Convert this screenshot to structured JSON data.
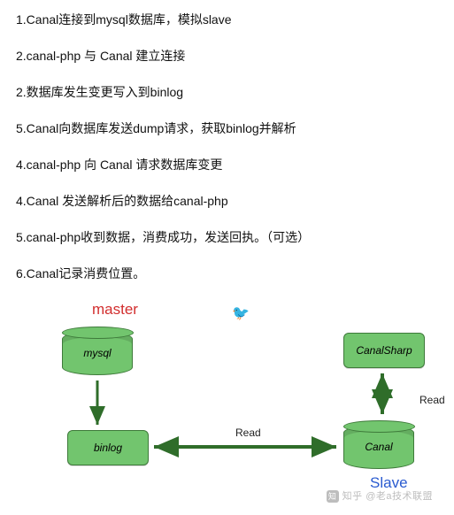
{
  "steps": {
    "s1": "1.Canal连接到mysql数据库，模拟slave",
    "s2": "2.canal-php 与 Canal 建立连接",
    "s3": "2.数据库发生变更写入到binlog",
    "s4": "5.Canal向数据库发送dump请求，获取binlog并解析",
    "s5": "4.canal-php 向 Canal 请求数据库变更",
    "s6": "4.Canal 发送解析后的数据给canal-php",
    "s7": "5.canal-php收到数据，消费成功，发送回执。（可选）",
    "s8": "6.Canal记录消费位置。"
  },
  "diagram": {
    "master": "master",
    "slave": "Slave",
    "mysql": "mysql",
    "binlog": "binlog",
    "canalsharp": "CanalSharp",
    "canal": "Canal",
    "read": "Read"
  },
  "icons": {
    "bird": "🐦"
  },
  "watermark": {
    "brand": "知",
    "text": "知乎 @老a技术联盟"
  }
}
